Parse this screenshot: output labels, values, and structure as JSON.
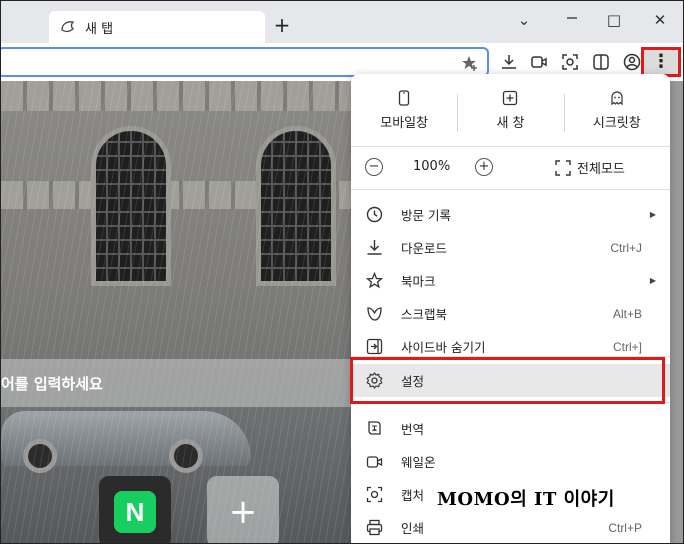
{
  "tab": {
    "title": "새 탭"
  },
  "window_controls": {
    "new_tab": "+",
    "minimize": "⌄",
    "restore": "□",
    "close": "✕"
  },
  "toolbar": {
    "menu_icon": "⋮"
  },
  "page": {
    "search_placeholder": "어를 입력하세요",
    "shortcut_naver": "N",
    "shortcut_add": "+"
  },
  "menu": {
    "quick": [
      {
        "label": "모바일창",
        "icon": "mobile-icon"
      },
      {
        "label": "새 창",
        "icon": "new-window-icon"
      },
      {
        "label": "시크릿창",
        "icon": "incognito-icon"
      }
    ],
    "zoom": {
      "minus": "−",
      "value": "100%",
      "plus": "+",
      "fullscreen_label": "전체모드"
    },
    "items": [
      {
        "label": "방문 기록",
        "shortcut": "",
        "submenu": true,
        "icon": "history-icon"
      },
      {
        "label": "다운로드",
        "shortcut": "Ctrl+J",
        "submenu": false,
        "icon": "download-icon"
      },
      {
        "label": "북마크",
        "shortcut": "",
        "submenu": true,
        "icon": "bookmark-star-icon"
      },
      {
        "label": "스크랩북",
        "shortcut": "Alt+B",
        "submenu": false,
        "icon": "scrapbook-icon"
      },
      {
        "label": "사이드바 숨기기",
        "shortcut": "Ctrl+]",
        "submenu": false,
        "icon": "sidebar-icon"
      },
      {
        "label": "설정",
        "shortcut": "",
        "submenu": false,
        "icon": "settings-icon"
      },
      {
        "label": "번역",
        "shortcut": "",
        "submenu": false,
        "icon": "translate-icon"
      },
      {
        "label": "웨일온",
        "shortcut": "",
        "submenu": false,
        "icon": "whale-on-icon"
      },
      {
        "label": "캡처",
        "shortcut": "",
        "submenu": false,
        "icon": "capture-icon"
      },
      {
        "label": "인쇄",
        "shortcut": "Ctrl+P",
        "submenu": false,
        "icon": "print-icon"
      }
    ],
    "submenu_arrow": "▶"
  },
  "watermark": "MOMO의 IT 이야기"
}
